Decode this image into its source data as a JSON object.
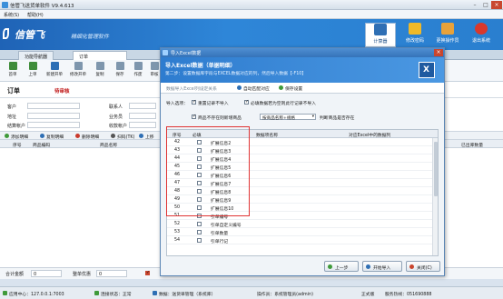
{
  "window": {
    "title": "信管飞送货单软件 V9.4.613"
  },
  "menu": [
    "系统(S)",
    "帮助(H)"
  ],
  "banner": {
    "logo": "信管飞",
    "slogan": "精细化管理软件",
    "buttons": [
      "计算器",
      "修改密码",
      "更换操作员",
      "退出系统"
    ],
    "accent": "#2a7fcf"
  },
  "tabs": [
    "功能导航器",
    "订单"
  ],
  "toolbar": [
    "首单",
    "上单",
    "新建开单",
    "修改开单",
    "复制",
    "保存",
    "作废",
    "审核"
  ],
  "order": {
    "heading": "订单",
    "status": "待审核"
  },
  "form_labels": {
    "customer": "客户",
    "contact": "联系人",
    "address": "地址",
    "salesman": "业务员",
    "settle": "结算帐户",
    "receivable": "收款帐户"
  },
  "subtoolbar": [
    "添加明细",
    "复制明细",
    "删除明细",
    "扫码(TK)",
    "上移"
  ],
  "grid_headers": [
    "序号",
    "商品编码",
    "商品名称",
    "已出库数量"
  ],
  "totals": {
    "total_label": "合计金额",
    "total_value": "0",
    "discount_label": "整单优惠",
    "discount_value": "0"
  },
  "statusbar": {
    "server": "应用中心：127.0.0.1:7003",
    "conn": "连接状态：正常",
    "module": "数据：送货单管理（系统库）",
    "user": "操作员：系统管理员(admin)",
    "version": "正式版",
    "phone": "服务热线：051690888"
  },
  "dialog": {
    "title": "导入Excel数据",
    "header_title": "导入Excel数据（单据明细）",
    "header_desc": "第二步：设置数据库字段与EXCEL数据对应的列，然后导入数据【-F10】",
    "steps": [
      "数据导入Excel列设定关系",
      "自动匹配对应",
      "保存设置"
    ],
    "opts_label": "导入选项：",
    "opt1": "重置记录不导入",
    "opt2": "必填数据若为空则此行记录不导入",
    "opt3": "商品不存在则新增商品",
    "select_value": "按商品名称+规格",
    "opt4": "判断商品是否存在",
    "col_headers": [
      "序号",
      "必填",
      "数据项名称",
      "对应Excel中的数据列"
    ],
    "rows": [
      {
        "no": "43",
        "name": "扩展信息3"
      },
      {
        "no": "44",
        "name": "扩展信息4"
      },
      {
        "no": "45",
        "name": "扩展信息5"
      },
      {
        "no": "46",
        "name": "扩展信息6"
      },
      {
        "no": "47",
        "name": "扩展信息7"
      },
      {
        "no": "48",
        "name": "扩展信息8"
      },
      {
        "no": "49",
        "name": "扩展信息9"
      },
      {
        "no": "50",
        "name": "扩展信息10"
      },
      {
        "no": "51",
        "name": "引单编号"
      },
      {
        "no": "52",
        "name": "引单自定义编号"
      },
      {
        "no": "53",
        "name": "引单数量"
      },
      {
        "no": "54",
        "name": "引单行记"
      }
    ],
    "first_row_no": "42",
    "first_row_name": "扩展信息2",
    "buttons": [
      "上一步",
      "开始导入",
      "关闭(C)"
    ]
  }
}
